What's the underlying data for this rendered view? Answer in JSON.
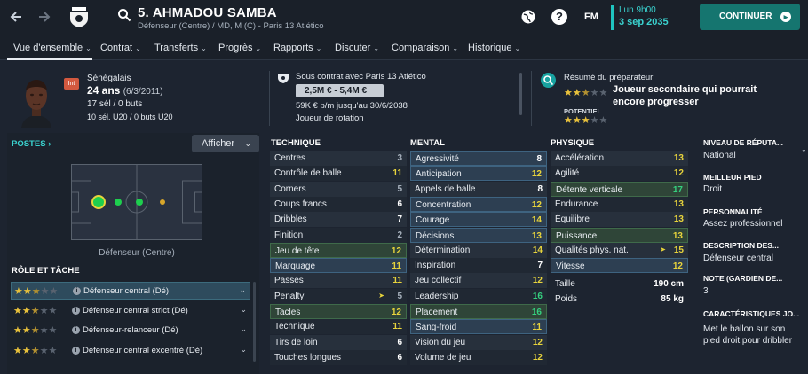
{
  "header": {
    "player_name": "5. AHMADOU SAMBA",
    "subtitle": "Défenseur (Centre) / MD, M (C) - Paris 13 Atlético",
    "help_icon": "?",
    "brand": "FM",
    "time": "Lun 9h00",
    "date": "3 sep 2035",
    "continue_label": "CONTINUER",
    "icons": [
      "back-arrow-icon",
      "forward-arrow-icon",
      "club-crest-icon",
      "search-icon",
      "world-icon",
      "help-icon",
      "play-icon"
    ]
  },
  "tabs": [
    {
      "label": "Vue d'ensemble",
      "chevron": "⌄",
      "active": true
    },
    {
      "label": "Contrat",
      "chevron": "⌄"
    },
    {
      "label": "Transferts",
      "chevron": "⌄"
    },
    {
      "label": "Progrès",
      "chevron": "⌄"
    },
    {
      "label": "Rapports",
      "chevron": "⌄"
    },
    {
      "label": "Discuter",
      "chevron": "⌄"
    },
    {
      "label": "Comparaison",
      "chevron": "⌄"
    },
    {
      "label": "Historique",
      "chevron": "⌄"
    }
  ],
  "summary": {
    "intl_badge": "Int",
    "nationality": "Sénégalais",
    "age": "24 ans",
    "dob": "(6/3/2011)",
    "caps": "17 sél / 0 buts",
    "u20_caps": "10 sél. U20 / 0 buts U20",
    "contract_title": "Sous contrat avec Paris 13 Atlético",
    "value_range": "2,5M € - 5,4M €",
    "wage": "59K € p/m jusqu'au 30/6/2038",
    "squad_status": "Joueur de rotation",
    "coach_title": "Résumé du préparateur",
    "coach_summary": "Joueur secondaire qui pourrait encore progresser",
    "potential_label": "POTENTIEL",
    "ability_stars": 2.5,
    "potential_stars": 3
  },
  "positions": {
    "title": "POSTES",
    "title_arrow": "›",
    "display_button": "Afficher",
    "position_label": "Défenseur (Centre)"
  },
  "roles": {
    "title": "RÔLE ET TÂCHE",
    "info_icon": "i",
    "items": [
      {
        "name": "Défenseur central (Dé)",
        "stars": 2.5,
        "selected": true
      },
      {
        "name": "Défenseur central strict (Dé)",
        "stars": 2.5
      },
      {
        "name": "Défenseur-relanceur (Dé)",
        "stars": 2.5
      },
      {
        "name": "Défenseur central excentré (Dé)",
        "stars": 2.5
      }
    ]
  },
  "technique": {
    "title": "TECHNIQUE",
    "rows": [
      {
        "name": "Centres",
        "value": "3"
      },
      {
        "name": "Contrôle de balle",
        "value": "11"
      },
      {
        "name": "Corners",
        "value": "5"
      },
      {
        "name": "Coups francs",
        "value": "6"
      },
      {
        "name": "Dribbles",
        "value": "7"
      },
      {
        "name": "Finition",
        "value": "2"
      },
      {
        "name": "Jeu de tête",
        "value": "12"
      },
      {
        "name": "Marquage",
        "value": "11"
      },
      {
        "name": "Passes",
        "value": "11"
      },
      {
        "name": "Penalty",
        "value": "5"
      },
      {
        "name": "Tacles",
        "value": "12"
      },
      {
        "name": "Technique",
        "value": "11"
      },
      {
        "name": "Tirs de loin",
        "value": "6"
      },
      {
        "name": "Touches longues",
        "value": "6"
      }
    ]
  },
  "mental": {
    "title": "MENTAL",
    "rows": [
      {
        "name": "Agressivité",
        "value": "8"
      },
      {
        "name": "Anticipation",
        "value": "12"
      },
      {
        "name": "Appels de balle",
        "value": "8"
      },
      {
        "name": "Concentration",
        "value": "12"
      },
      {
        "name": "Courage",
        "value": "14"
      },
      {
        "name": "Décisions",
        "value": "13"
      },
      {
        "name": "Détermination",
        "value": "14"
      },
      {
        "name": "Inspiration",
        "value": "7"
      },
      {
        "name": "Jeu collectif",
        "value": "12"
      },
      {
        "name": "Leadership",
        "value": "16"
      },
      {
        "name": "Placement",
        "value": "16"
      },
      {
        "name": "Sang-froid",
        "value": "11"
      },
      {
        "name": "Vision du jeu",
        "value": "12"
      },
      {
        "name": "Volume de jeu",
        "value": "12"
      }
    ]
  },
  "physique": {
    "title": "PHYSIQUE",
    "rows": [
      {
        "name": "Accélération",
        "value": "13"
      },
      {
        "name": "Agilité",
        "value": "12"
      },
      {
        "name": "Détente verticale",
        "value": "17"
      },
      {
        "name": "Endurance",
        "value": "13"
      },
      {
        "name": "Équilibre",
        "value": "13"
      },
      {
        "name": "Puissance",
        "value": "13"
      },
      {
        "name": "Qualités phys. nat.",
        "value": "15"
      },
      {
        "name": "Vitesse",
        "value": "12"
      }
    ],
    "height_label": "Taille",
    "height": "190 cm",
    "weight_label": "Poids",
    "weight": "85 kg"
  },
  "details": [
    {
      "label": "NIVEAU DE RÉPUTA...",
      "value": "National"
    },
    {
      "label": "MEILLEUR PIED",
      "value": "Droit"
    },
    {
      "label": "PERSONNALITÉ",
      "value": "Assez professionnel"
    },
    {
      "label": "DESCRIPTION DES...",
      "value": "Défenseur central"
    },
    {
      "label": "NOTE (GARDIEN DE...",
      "value": "3"
    },
    {
      "label": "CARACTÉRISTIQUES JO...",
      "value": "Met le ballon sur son pied droit pour dribbler"
    }
  ],
  "colors": {
    "accent_teal": "#1fc4c0",
    "continue_btn": "#15756f",
    "attr_yellow": "#e8d43c",
    "attr_green": "#35d07f",
    "star": "#e8c13c"
  }
}
